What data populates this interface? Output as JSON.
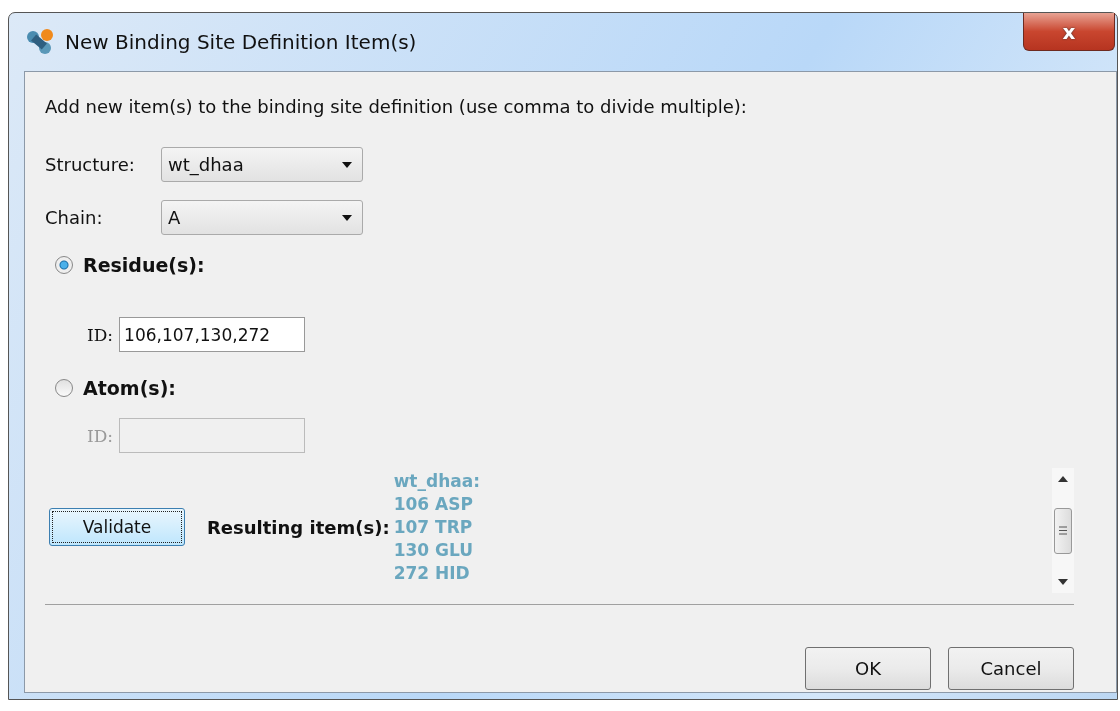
{
  "window": {
    "title": "New Binding Site Definition Item(s)",
    "close": "x"
  },
  "instruction": "Add new item(s) to the binding site definition (use comma to divide multiple):",
  "dropdowns": [
    {
      "label": "Structure:",
      "value": "wt_dhaa"
    },
    {
      "label": "Chain:",
      "value": "A"
    }
  ],
  "modes": [
    {
      "label": "Residue(s):",
      "selected": true,
      "id_field": {
        "label": "ID:",
        "value": "106,107,130,272",
        "disabled": false
      }
    },
    {
      "label": "Atom(s):",
      "selected": false,
      "id_field": {
        "label": "ID:",
        "disabled": true
      }
    }
  ],
  "validate_button": "Validate",
  "results_label": "Resulting item(s):",
  "results": [
    "wt_dhaa:",
    "106 ASP",
    "107 TRP",
    "130 GLU",
    "272 HID"
  ],
  "buttons": [
    "OK",
    "Cancel"
  ]
}
